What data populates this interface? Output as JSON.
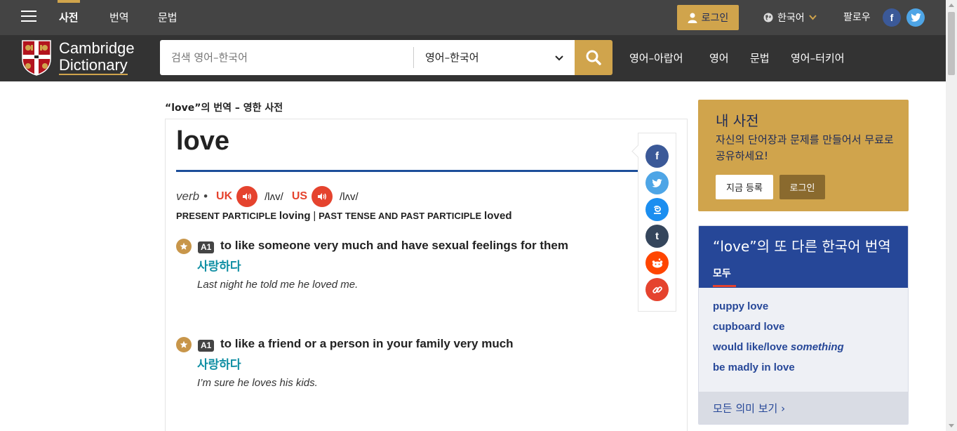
{
  "topnav": {
    "items": [
      "사전",
      "번역",
      "문법"
    ],
    "login_label": "로그인",
    "language": "한국어",
    "follow_label": "팔로우"
  },
  "header": {
    "logo_line1": "Cambridge",
    "logo_line2": "Dictionary",
    "search_placeholder": "검색 영어–한국어",
    "dictionary_selected": "영어–한국어",
    "links": [
      "영어–아랍어",
      "영어",
      "문법",
      "영어–터키어"
    ]
  },
  "entry": {
    "page_heading": "“love”의 번역 – 영한 사전",
    "headword": "love",
    "pos": "verb",
    "uk_label": "UK",
    "uk_ipa": "/lʌv/",
    "us_label": "US",
    "us_ipa": "/lʌv/",
    "inflection1_label": "PRESENT PARTICIPLE",
    "inflection1_form": "loving",
    "inflection_sep": "|",
    "inflection2_label": "PAST TENSE AND PAST PARTICIPLE",
    "inflection2_form": "loved",
    "senses": [
      {
        "level": "A1",
        "definition": "to like someone very much and have sexual feelings for them",
        "translation": "사랑하다",
        "example": "Last night he told me he loved me."
      },
      {
        "level": "A1",
        "definition": "to like a friend or a person in your family very much",
        "translation": "사랑하다",
        "example": "I’m sure he loves his kids."
      }
    ]
  },
  "share_icons": [
    "facebook-icon",
    "twitter-icon",
    "delicious-icon",
    "tumblr-icon",
    "reddit-icon",
    "link-icon"
  ],
  "my_dictionary": {
    "title": "내 사전",
    "description": "자신의 단어장과 문제를 만들어서 무료로 공유하세요!",
    "signup_label": "지금 등록",
    "login_label": "로그인"
  },
  "more_translations": {
    "title": "“love”의 또 다른 한국어 번역",
    "tab": "모두",
    "links": [
      {
        "text": "puppy love",
        "italic": ""
      },
      {
        "text": "cupboard love",
        "italic": ""
      },
      {
        "text": "would like/love ",
        "italic": "something"
      },
      {
        "text": "be madly in love",
        "italic": ""
      }
    ],
    "see_all": "모든 의미 보기",
    "see_all_arrow": "›"
  },
  "colors": {
    "topbar": "#444444",
    "header": "#333333",
    "accent_gold": "#d0a44c",
    "navy": "#264798",
    "red": "#e5432e",
    "teal": "#0e8ea3"
  }
}
